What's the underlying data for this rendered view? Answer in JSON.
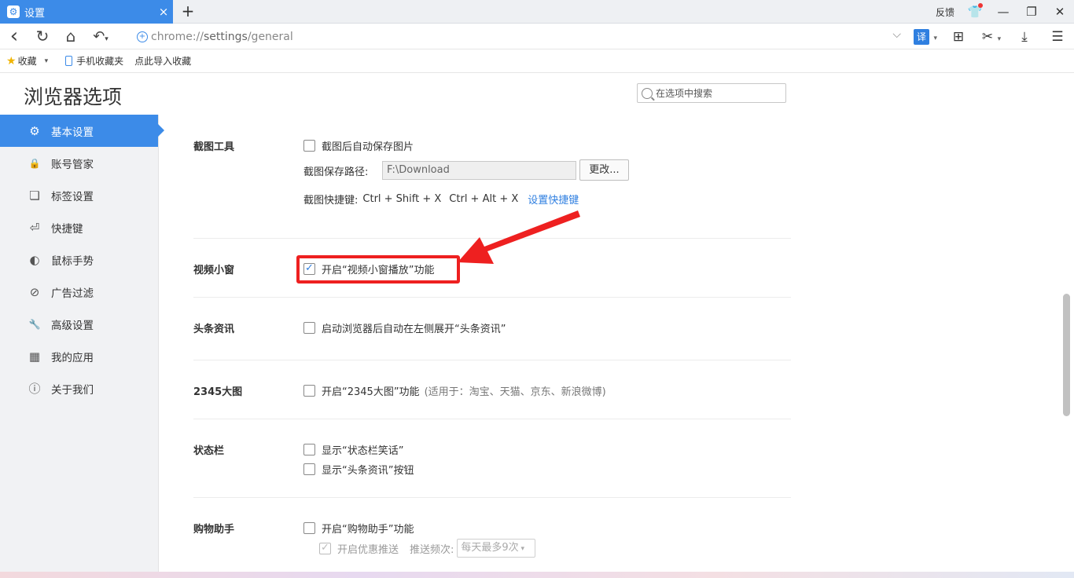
{
  "tab": {
    "title": "设置",
    "icon": "gear-icon",
    "close": "×",
    "new_tab": "+"
  },
  "window": {
    "feedback": "反馈",
    "minimize": "—",
    "restore": "❐",
    "close": "✕"
  },
  "address_bar": {
    "url_prefix": "chrome://",
    "url_host": "settings",
    "url_path": "/general",
    "dropdown": "⌵"
  },
  "nav": {
    "back": "‹",
    "reload": "↻",
    "home": "⌂",
    "undo": "↶"
  },
  "toolbar_right": {
    "translate": "译"
  },
  "bookmarks": [
    {
      "label": "收藏"
    },
    {
      "label": "手机收藏夹"
    },
    {
      "label": "点此导入收藏"
    }
  ],
  "page": {
    "title": "浏览器选项",
    "search_placeholder": "在选项中搜索"
  },
  "sidebar": {
    "items": [
      {
        "label": "基本设置",
        "icon": "⚙",
        "active": true
      },
      {
        "label": "账号管家",
        "icon": "🔒"
      },
      {
        "label": "标签设置",
        "icon": "❏"
      },
      {
        "label": "快捷键",
        "icon": "⏎"
      },
      {
        "label": "鼠标手势",
        "icon": "◐"
      },
      {
        "label": "广告过滤",
        "icon": "⊘"
      },
      {
        "label": "高级设置",
        "icon": "🔧"
      },
      {
        "label": "我的应用",
        "icon": "▦"
      },
      {
        "label": "关于我们",
        "icon": "ⓘ"
      }
    ]
  },
  "settings": {
    "screenshot": {
      "label": "截图工具",
      "auto_save": "截图后自动保存图片",
      "path_label": "截图保存路径:",
      "path_value": "F:\\Download",
      "change_button": "更改...",
      "shortcut_label": "截图快捷键:",
      "shortcut1": "Ctrl + Shift + X",
      "shortcut2": "Ctrl + Alt + X",
      "shortcut_link": "设置快捷键"
    },
    "video": {
      "label": "视频小窗",
      "option": "开启“视频小窗播放”功能",
      "checked": true
    },
    "news": {
      "label": "头条资讯",
      "option": "启动浏览器后自动在左侧展开“头条资讯”"
    },
    "bigpic": {
      "label": "2345大图",
      "option": "开启“2345大图”功能",
      "hint": "(适用于：淘宝、天猫、京东、新浪微博)"
    },
    "statusbar": {
      "label": "状态栏",
      "option1": "显示“状态栏笑话”",
      "option2": "显示“头条资讯”按钮"
    },
    "shopping": {
      "label": "购物助手",
      "option": "开启“购物助手”功能",
      "sub_option": "开启优惠推送",
      "freq_label": "推送频次:",
      "freq_value": "每天最多9次"
    }
  },
  "colors": {
    "accent": "#3c8be8",
    "annotation": "#ee2020"
  }
}
